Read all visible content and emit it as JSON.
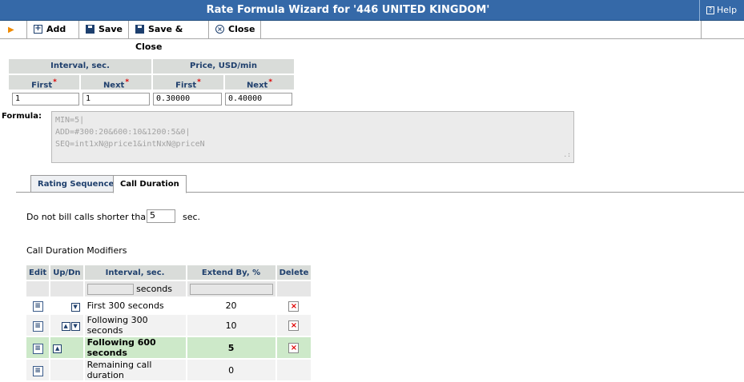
{
  "window": {
    "title": "Rate Formula Wizard for '446 UNITED KINGDOM'",
    "help_label": "Help"
  },
  "toolbar": {
    "add_label": "Add",
    "save_label": "Save",
    "save_close_label": "Save & Close",
    "close_label": "Close"
  },
  "grid": {
    "interval_header": "Interval, sec.",
    "price_header": "Price, USD/min",
    "first_label": "First",
    "next_label": "Next",
    "interval_first": "1",
    "interval_next": "1",
    "price_first": "0.30000",
    "price_next": "0.40000"
  },
  "formula": {
    "label": "Formula:",
    "line1": "MIN=5|",
    "line2": "ADD=#300:20&600:10&1200:5&0|",
    "line3": "SEQ=int1xN@price1&intNxN@priceN"
  },
  "tabs": {
    "rating_sequence": "Rating Sequence",
    "call_duration": "Call Duration"
  },
  "call_duration": {
    "min_label": "Do not bill calls shorter than",
    "min_value": "5",
    "unit": "sec.",
    "modifiers_title": "Call Duration Modifiers"
  },
  "modifiers_table": {
    "headers": {
      "edit": "Edit",
      "updn": "Up/Dn",
      "interval": "Interval, sec.",
      "extend": "Extend By, %",
      "delete": "Delete"
    },
    "filter_unit": "seconds",
    "rows": [
      {
        "interval": "First 300 seconds",
        "extend": "20"
      },
      {
        "interval": "Following 300 seconds",
        "extend": "10"
      },
      {
        "interval": "Following 600 seconds",
        "extend": "5"
      },
      {
        "interval": "Remaining call duration",
        "extend": "0"
      }
    ]
  },
  "colors": {
    "titlebar": "#3569a8",
    "header_text": "#20406d",
    "highlight_row": "#cde9c9",
    "delete_x": "#e00000"
  }
}
